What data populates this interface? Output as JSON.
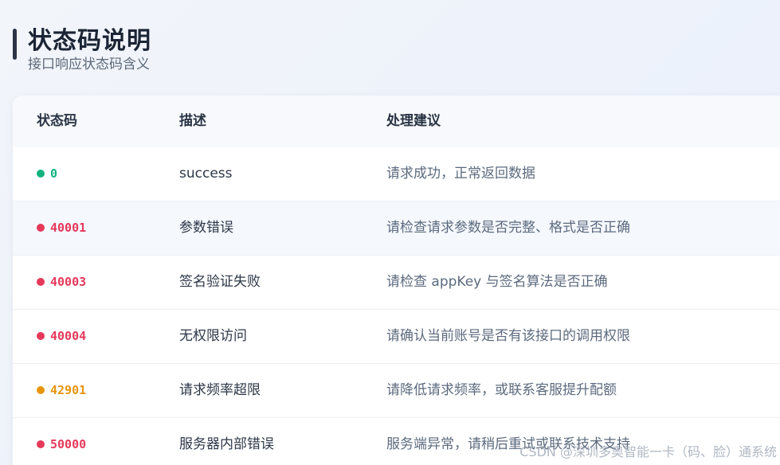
{
  "header": {
    "title": "状态码说明",
    "subtitle": "接口响应状态码含义"
  },
  "table": {
    "columns": {
      "code": "状态码",
      "desc": "描述",
      "tip": "处理建议"
    },
    "rows": [
      {
        "code": "0",
        "desc": "success",
        "tip": "请求成功，正常返回数据",
        "color": "#10b27e"
      },
      {
        "code": "40001",
        "desc": "参数错误",
        "tip": "请检查请求参数是否完整、格式是否正确",
        "color": "#e5395a"
      },
      {
        "code": "40003",
        "desc": "签名验证失败",
        "tip": "请检查 appKey 与签名算法是否正确",
        "color": "#e5395a"
      },
      {
        "code": "40004",
        "desc": "无权限访问",
        "tip": "请确认当前账号是否有该接口的调用权限",
        "color": "#e5395a"
      },
      {
        "code": "42901",
        "desc": "请求频率超限",
        "tip": "请降低请求频率，或联系客服提升配额",
        "color": "#e8950e"
      },
      {
        "code": "50000",
        "desc": "服务器内部错误",
        "tip": "服务端异常，请稍后重试或联系技术支持",
        "color": "#e5395a"
      }
    ]
  },
  "watermark": "CSDN @深圳多奥智能一卡（码、脸）通系统"
}
